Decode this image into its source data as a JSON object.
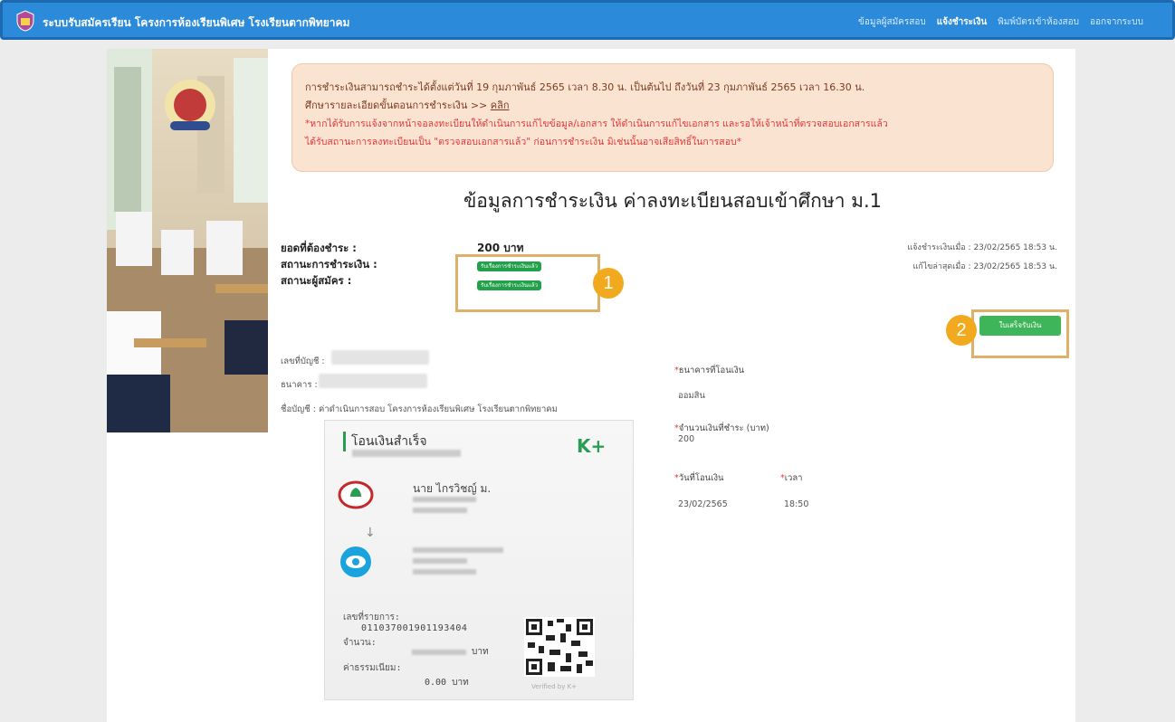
{
  "navbar": {
    "title": "ระบบรับสมัครเรียน โครงการห้องเรียนพิเศษ โรงเรียนตากพิทยาคม",
    "menu": [
      "ข้อมูลผู้สมัครสอบ",
      "แจ้งชำระเงิน",
      "พิมพ์บัตรเข้าห้องสอบ",
      "ออกจากระบบ"
    ]
  },
  "alert": {
    "line1": "การชำระเงินสามารถชำระได้ตั้งแต่วันที่ 19 กุมภาพันธ์ 2565 เวลา 8.30 น. เป็นต้นไป ถึงวันที่ 23 กุมภาพันธ์ 2565 เวลา 16.30 น.",
    "line2": "ศึกษารายละเอียดขั้นตอนการชำระเงิน >> ",
    "line2_link": "คลิก",
    "red1": "*หากได้รับการแจ้งจากหน้าจอลงทะเบียนให้ดำเนินการแก้ไขข้อมูล/เอกสาร ให้ดำเนินการแก้ไขเอกสาร และรอให้เจ้าหน้าที่ตรวจสอบเอกสารแล้ว",
    "red2": "ได้รับสถานะการลงทะเบียนเป็น \"ตรวจสอบเอกสารแล้ว\" ก่อนการชำระเงิน มิเช่นนั้นอาจเสียสิทธิ์ในการสอบ*"
  },
  "page_title": "ข้อมูลการชำระเงิน ค่าลงทะเบียนสอบเข้าศึกษา ม.1",
  "summary": {
    "amount_label": "ยอดที่ต้องชำระ :",
    "amount_value": "200 บาท",
    "payment_status_label": "สถานะการชำระเงิน :",
    "payment_status_badge": "รับเรื่องการชำระเงินแล้ว",
    "applicant_status_label": "สถานะผู้สมัคร :",
    "applicant_status_badge": "รับเรื่องการชำระเงินแล้ว",
    "notified_at": "แจ้งชำระเงินเมื่อ : 23/02/2565 18:53 น.",
    "updated_at": "แก้ไขล่าสุดเมื่อ : 23/02/2565 18:53 น."
  },
  "steps": {
    "one": "1",
    "two": "2"
  },
  "receipt_button": "ใบเสร็จรับเงิน",
  "account": {
    "number_label": "เลขที่บัญชี :",
    "bank_label": "ธนาคาร :",
    "name_line": "ชื่อบัญชี : ค่าดำเนินการสอบ โครงการห้องเรียนพิเศษ โรงเรียนตากพิทยาคม"
  },
  "form": {
    "bank_label": "ธนาคารที่โอนเงิน",
    "bank_value": "ออมสิน",
    "amount_label": "จำนวนเงินที่ชำระ (บาท)",
    "amount_value": "200",
    "date_label": "วันที่โอนเงิน",
    "date_value": "23/02/2565",
    "time_label": "เวลา",
    "time_value": "18:50",
    "required_mark": "*"
  },
  "slip": {
    "title": "โอนเงินสำเร็จ",
    "brand": "K+",
    "sender_name": "นาย ไกรวิชญ์ ม.",
    "ref_label": "เลขที่รายการ:",
    "ref_number": "011037001901193404",
    "amount_label": "จำนวน:",
    "amount_unit": "บาท",
    "fee_label": "ค่าธรรมเนียม:",
    "fee_value": "0.00 บาท",
    "verified": "Verified by K+"
  },
  "colors": {
    "navbar": "#2b8ad9",
    "badge": "#22a14a",
    "alert_bg": "#fbe3d1",
    "step": "#f1a91d",
    "kbank": "#2a9d55"
  }
}
